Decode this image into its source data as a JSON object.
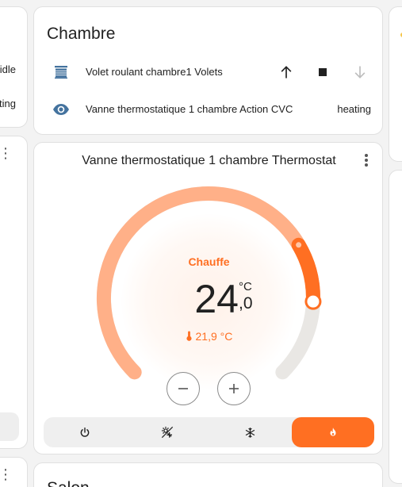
{
  "left_column": {
    "row1_state": "idle",
    "row2_state": "ting"
  },
  "chambre": {
    "title": "Chambre",
    "entities": [
      {
        "name": "Volet roulant chambre1 Volets",
        "icon": "window-shutter-icon"
      },
      {
        "name": "Vanne thermostatique 1 chambre Action CVC",
        "state": "heating",
        "icon": "eye-icon"
      }
    ]
  },
  "thermostat": {
    "title": "Vanne thermostatique 1 chambre Thermostat",
    "hvac_action": "Chauffe",
    "target_integer": "24",
    "target_decimal": ",0",
    "unit": "°C",
    "current_temperature": "21,9 °C",
    "current_icon": "thermometer-icon",
    "minus_label": "−",
    "plus_label": "+",
    "modes": [
      {
        "name": "off",
        "icon": "power-icon"
      },
      {
        "name": "auto",
        "icon": "sun-snowflake-icon"
      },
      {
        "name": "cool",
        "icon": "snowflake-icon"
      },
      {
        "name": "heat",
        "icon": "fire-icon",
        "active": true
      }
    ],
    "colors": {
      "accent": "#ff6f22",
      "arc_fill": "#ffb088",
      "track": "#e9e7e4"
    },
    "dial": {
      "min_value_fraction": 0,
      "current_fraction": 0.72,
      "target_fraction": 0.84
    }
  },
  "salon": {
    "title": "Salon"
  }
}
